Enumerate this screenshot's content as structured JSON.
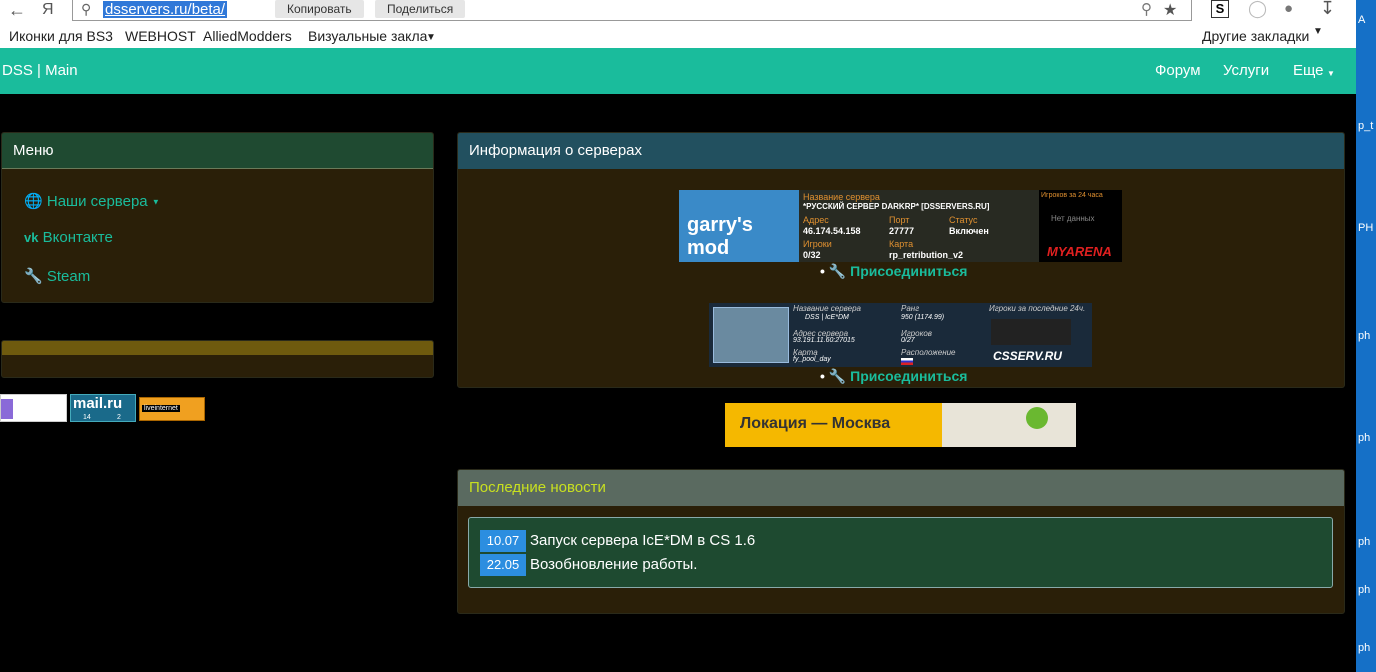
{
  "browser": {
    "url": "dsservers.ru/beta/",
    "copy_label": "Копировать",
    "share_label": "Поделиться",
    "logo_letter": "Я",
    "bookmarks": [
      "Иконки для BS3",
      "WEBHOST",
      "AlliedModders",
      "Визуальные закла"
    ],
    "other_bookmarks": "Другие закладки"
  },
  "desktop_strip": [
    "А",
    "p_t",
    "PH",
    "ph",
    "ph",
    "ph",
    "ph",
    "ph"
  ],
  "navbar": {
    "brand": "DSS | Main",
    "links": [
      "Форум",
      "Услуги",
      "Еще"
    ]
  },
  "menu": {
    "title": "Меню",
    "items": [
      "Наши сервера",
      "Вконтакте",
      "Steam"
    ]
  },
  "servers": {
    "title": "Информация о серверах",
    "join_label": "Присоединиться",
    "server1": {
      "name_label": "Название сервера",
      "name": "*РУССКИЙ СЕРВЕР DARKRP* [DSSERVERS.RU]",
      "addr_label": "Адрес",
      "addr": "46.174.54.158",
      "port_label": "Порт",
      "port": "27777",
      "status_label": "Статус",
      "status": "Включен",
      "players_label": "Игроки",
      "players": "0/32",
      "map_label": "Карта",
      "map": "rp_retribution_v2",
      "graph_label": "Игроков за 24 часа",
      "no_data": "Нет данных",
      "game_logo": "garry's mod",
      "brand": "MYARENA"
    },
    "server2": {
      "name_label": "Название сервера",
      "name": "DSS | IcE*DM",
      "rank_label": "Ранг",
      "rank": "950  (1174.99)",
      "graph_label": "Игроки за последние 24ч.",
      "addr_label": "Адрес сервера",
      "addr": "93.191.11.60:27015",
      "players_label": "Игроков",
      "players": "0/27",
      "map_label": "Карта",
      "map": "fy_pool_day",
      "location_label": "Расположение",
      "brand": "CSSERV.RU"
    },
    "location": "Локация — Москва"
  },
  "counters": {
    "mailru": "mail.ru",
    "mailru_a": "14",
    "mailru_b": "2",
    "liveinternet": "liveinternet"
  },
  "news": {
    "title": "Последние новости",
    "items": [
      {
        "date": "10.07",
        "text": "Запуск сервера IcE*DM в CS 1.6"
      },
      {
        "date": "22.05",
        "text": "Возобновление работы."
      }
    ]
  }
}
